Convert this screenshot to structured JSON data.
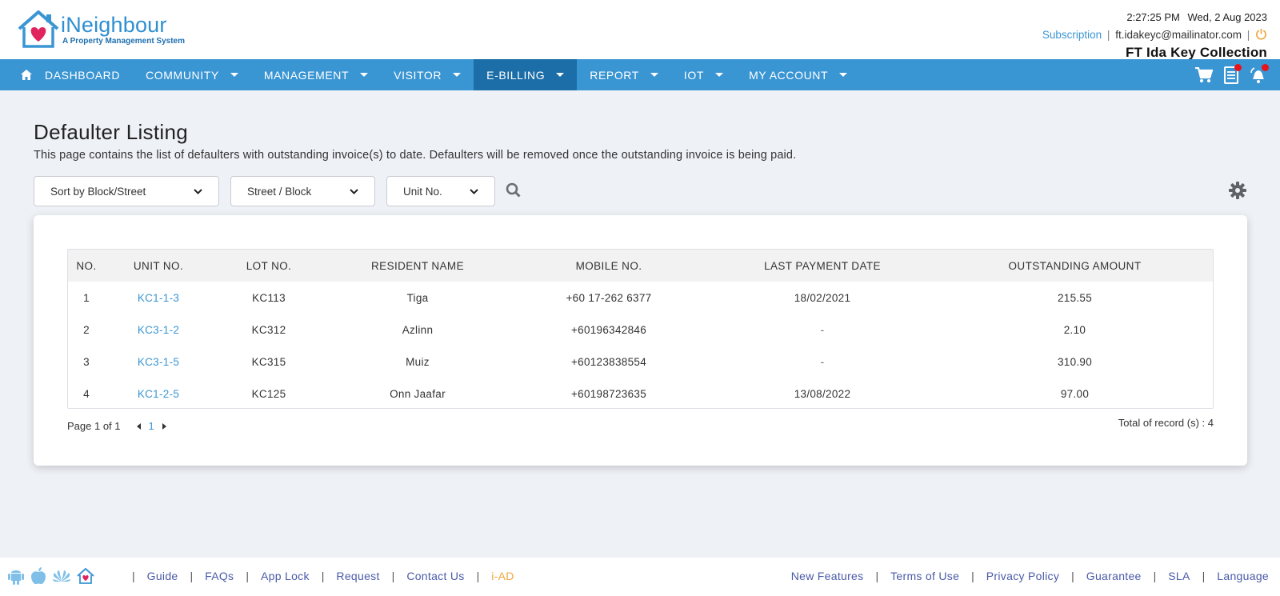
{
  "header": {
    "logo_name": "iNeighbour",
    "logo_tagline": "A Property Management System",
    "time": "2:27:25 PM",
    "date": "Wed, 2 Aug 2023",
    "subscription_label": "Subscription",
    "email": "ft.idakeyc@mailinator.com",
    "company": "FT Ida Key Collection"
  },
  "nav": {
    "items": [
      {
        "label": "DASHBOARD"
      },
      {
        "label": "COMMUNITY"
      },
      {
        "label": "MANAGEMENT"
      },
      {
        "label": "VISITOR"
      },
      {
        "label": "E-BILLING"
      },
      {
        "label": "REPORT"
      },
      {
        "label": "IOT"
      },
      {
        "label": "MY ACCOUNT"
      }
    ],
    "active": "E-BILLING",
    "accent": "#3a95d3",
    "active_color": "#1b6ea8"
  },
  "page": {
    "title": "Defaulter Listing",
    "description": "This page contains the list of defaulters with outstanding invoice(s) to date. Defaulters will be removed once the outstanding invoice is being paid."
  },
  "filters": {
    "sort": "Sort by Block/Street",
    "street": "Street / Block",
    "unit": "Unit No."
  },
  "table": {
    "headers": {
      "no": "NO.",
      "unit": "UNIT NO.",
      "lot": "LOT NO.",
      "name": "RESIDENT NAME",
      "mobile": "MOBILE NO.",
      "last": "LAST PAYMENT DATE",
      "amount": "OUTSTANDING AMOUNT"
    },
    "rows": [
      {
        "no": "1",
        "unit": "KC1-1-3",
        "lot": "KC113",
        "name": "Tiga",
        "mobile": "+60 17-262 6377",
        "last": "18/02/2021",
        "amount": "215.55"
      },
      {
        "no": "2",
        "unit": "KC3-1-2",
        "lot": "KC312",
        "name": "Azlinn",
        "mobile": "+60196342846",
        "last": "-",
        "amount": "2.10"
      },
      {
        "no": "3",
        "unit": "KC3-1-5",
        "lot": "KC315",
        "name": "Muiz",
        "mobile": "+60123838554",
        "last": "-",
        "amount": "310.90"
      },
      {
        "no": "4",
        "unit": "KC1-2-5",
        "lot": "KC125",
        "name": "Onn Jaafar",
        "mobile": "+60198723635",
        "last": "13/08/2022",
        "amount": "97.00"
      }
    ]
  },
  "pagination": {
    "page_text": "Page 1 of 1",
    "current": "1",
    "total_text": "Total of record (s) : 4"
  },
  "footer": {
    "left_links": [
      "Guide",
      "FAQs",
      "App Lock",
      "Request",
      "Contact Us",
      "i-AD"
    ],
    "right_links": [
      "New Features",
      "Terms of Use",
      "Privacy Policy",
      "Guarantee",
      "SLA",
      "Language"
    ],
    "app_icons": [
      "android-icon",
      "apple-icon",
      "huawei-icon",
      "ineighbour-app-icon"
    ]
  }
}
